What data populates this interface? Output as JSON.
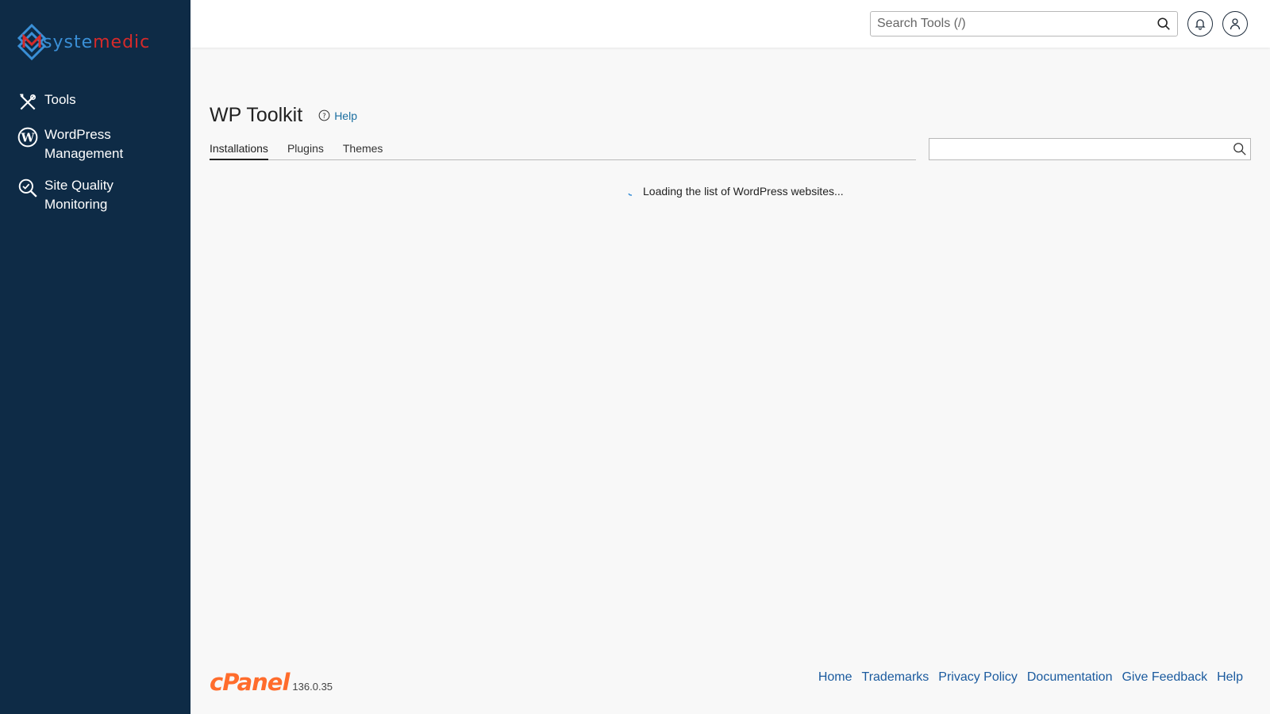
{
  "brand": {
    "logo_text_part1": "syste",
    "logo_text_part2": "medic",
    "logo_icon": "systemedic-logo-icon",
    "colors": {
      "sidebar_bg": "#0e2b46",
      "logo_blue": "#3a8fd6",
      "logo_red": "#d62a2a",
      "link": "#1a5a9e",
      "cpanel_orange": "#ff6c2c"
    }
  },
  "sidebar": {
    "items": [
      {
        "label": "Tools",
        "icon": "tools-icon"
      },
      {
        "label": "WordPress Management",
        "icon": "wordpress-icon"
      },
      {
        "label": "Site Quality Monitoring",
        "icon": "site-quality-icon"
      }
    ]
  },
  "header": {
    "search_placeholder": "Search Tools (/)",
    "notifications_icon": "bell-icon",
    "user_icon": "user-icon"
  },
  "main": {
    "title": "WP Toolkit",
    "help_label": "Help",
    "tabs": [
      {
        "label": "Installations",
        "active": true
      },
      {
        "label": "Plugins",
        "active": false
      },
      {
        "label": "Themes",
        "active": false
      }
    ],
    "filter_search_value": "",
    "loading_text": "Loading the list of WordPress websites..."
  },
  "footer": {
    "logo_text": "cPanel",
    "version": "136.0.35",
    "links": [
      "Home",
      "Trademarks",
      "Privacy Policy",
      "Documentation",
      "Give Feedback",
      "Help"
    ]
  }
}
